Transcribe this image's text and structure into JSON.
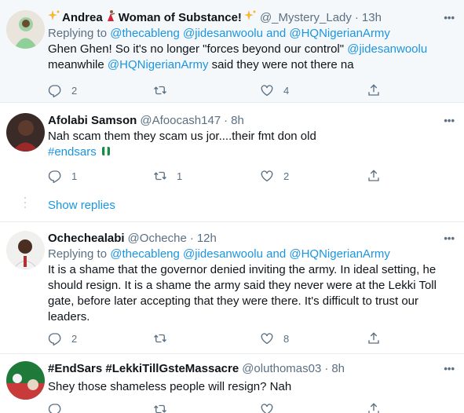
{
  "tweets": [
    {
      "name_pre": "",
      "name_main": "Andrea",
      "name_mid": "Woman of Substance!",
      "handle": "@_Mystery_Lady",
      "time": "13h",
      "replying_prefix": "Replying to",
      "replying_1": "@thecableng",
      "replying_2": "@jidesanwoolu",
      "replying_and": "and",
      "replying_3": "@HQNigerianArmy",
      "text_1": "Ghen Ghen! So it's no longer \"forces beyond our control\"",
      "text_mention_1": "@jidesanwoolu",
      "text_2": "meanwhile",
      "text_mention_2": "@HQNigerianArmy",
      "text_3": "said they were not there na",
      "reply_count": "2",
      "retweet_count": "",
      "like_count": "4"
    },
    {
      "name": "Afolabi Samson",
      "handle": "@Afoocash147",
      "time": "8h",
      "text_1": "Nah scam them they scam us jor....their fmt don old",
      "hashtag": "#endsars",
      "reply_count": "1",
      "retweet_count": "1",
      "like_count": "2"
    },
    {
      "name": "Ochechealabi",
      "handle": "@Ocheche",
      "time": "12h",
      "replying_prefix": "Replying to",
      "replying_1": "@thecableng",
      "replying_2": "@jidesanwoolu",
      "replying_and": "and",
      "replying_3": "@HQNigerianArmy",
      "text_1": "It is a shame that the governor denied inviting the army.  In ideal setting, he should resign. It is a shame the army said they never were at the Lekki Toll gate, before later accepting that they were there.  It's difficult to trust our leaders.",
      "reply_count": "2",
      "retweet_count": "",
      "like_count": "8"
    },
    {
      "name": "#EndSars #LekkiTillGsteMassacre",
      "handle": "@oluthomas03",
      "time": "8h",
      "text_1": "Shey those shameless people will resign? Nah",
      "reply_count": "",
      "retweet_count": "",
      "like_count": ""
    }
  ],
  "show_replies": "Show replies",
  "more_glyph": "•••",
  "dot": "·",
  "colors": {
    "link": "#1b95e0",
    "muted": "#5b7083",
    "highlight_bg": "#f5f8fa",
    "border": "#e6ecf0"
  }
}
